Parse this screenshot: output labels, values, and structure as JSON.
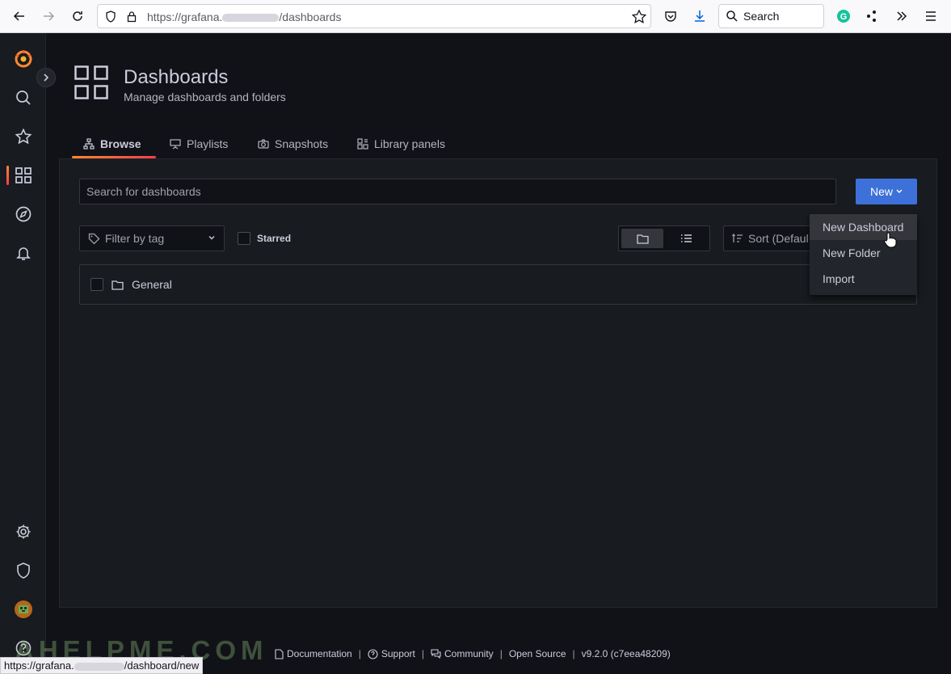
{
  "browser": {
    "url_prefix": "https://grafana.",
    "url_suffix": "/dashboards",
    "search_label": "Search"
  },
  "header": {
    "title": "Dashboards",
    "subtitle": "Manage dashboards and folders"
  },
  "tabs": [
    {
      "label": "Browse",
      "icon": "sitemap-icon",
      "active": true
    },
    {
      "label": "Playlists",
      "icon": "presentation-icon",
      "active": false
    },
    {
      "label": "Snapshots",
      "icon": "camera-icon",
      "active": false
    },
    {
      "label": "Library panels",
      "icon": "library-panels-icon",
      "active": false
    }
  ],
  "search": {
    "placeholder": "Search for dashboards"
  },
  "new_button": {
    "label": "New"
  },
  "filters": {
    "tag_placeholder": "Filter by tag",
    "starred_label": "Starred",
    "sort_label": "Sort (Defaul"
  },
  "folders": [
    {
      "name": "General"
    }
  ],
  "new_menu": {
    "items": [
      "New Dashboard",
      "New Folder",
      "Import"
    ],
    "hovered": "New Dashboard"
  },
  "footer": {
    "documentation": "Documentation",
    "support": "Support",
    "community": "Community",
    "open_source": "Open Source",
    "version": "v9.2.0 (c7eea48209)"
  },
  "status_bar": {
    "url_prefix": "https://grafana.",
    "url_suffix": "/dashboard/new"
  },
  "watermark": "AHELPME.COM",
  "colors": {
    "primary": "#3d71d9",
    "accent": "#ff8833",
    "background": "#111217",
    "panel": "#181b1f"
  }
}
